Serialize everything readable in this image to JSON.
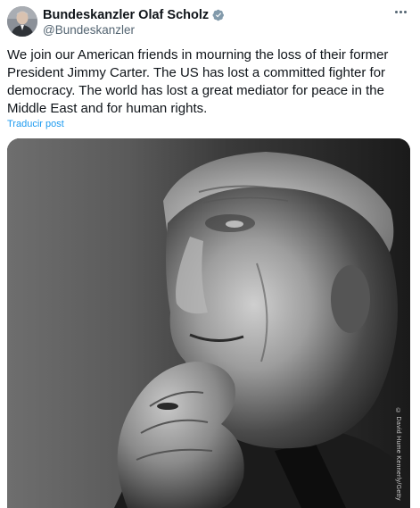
{
  "author": {
    "display_name": "Bundeskanzler Olaf Scholz",
    "handle": "@Bundeskanzler",
    "verified": true
  },
  "tweet": {
    "text": "We join our American friends in mourning the loss of their former President Jimmy Carter. The US has lost a committed fighter for democracy. The world has lost a great mediator for peace in the Middle East and for human rights.",
    "translate_label": "Traducir post"
  },
  "media": {
    "credit": "© David Hume Kennerly/Getty"
  },
  "icons": {
    "verified": "verified-badge-icon",
    "more": "more-options-icon"
  },
  "colors": {
    "link": "#1d9bf0",
    "secondary_text": "#536471",
    "verified_badge": "#829aab"
  }
}
